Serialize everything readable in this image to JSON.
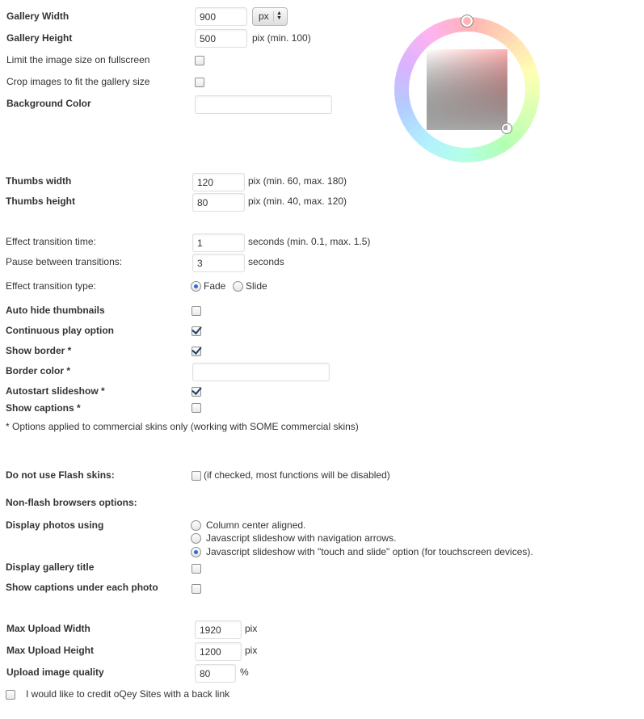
{
  "gallery": {
    "width_label": "Gallery Width",
    "width_value": "900",
    "unit_value": "px",
    "height_label": "Gallery Height",
    "height_value": "500",
    "height_hint": "pix (min. 100)",
    "limit_label": "Limit the image size on fullscreen",
    "limit_checked": false,
    "crop_label": "Crop images to fit the gallery size",
    "crop_checked": false,
    "bg_color_label": "Background Color",
    "bg_color_value": ""
  },
  "color_picker": {
    "ring_colors": [
      "#ffb3b3",
      "#ffd9b3",
      "#ffffb3",
      "#d9ffb3",
      "#b3ffb3",
      "#b3ffe6",
      "#b3f0ff",
      "#b3ccff",
      "#d9b3ff",
      "#ffb3f0"
    ],
    "selected_hue": "#ffb3b3"
  },
  "thumbs": {
    "width_label": "Thumbs width",
    "width_value": "120",
    "width_hint": "pix (min. 60, max. 180)",
    "height_label": "Thumbs height",
    "height_value": "80",
    "height_hint": "pix (min. 40, max. 120)"
  },
  "effects": {
    "time_label": "Effect transition time:",
    "time_value": "1",
    "time_hint": "seconds (min. 0.1, max. 1.5)",
    "pause_label": "Pause between transitions:",
    "pause_value": "3",
    "pause_hint": "seconds",
    "type_label": "Effect transition type:",
    "type_options": [
      "Fade",
      "Slide"
    ],
    "type_selected": "Fade"
  },
  "options": {
    "auto_hide_label": "Auto hide thumbnails",
    "auto_hide_checked": false,
    "continuous_label": "Continuous play option",
    "continuous_checked": true,
    "show_border_label": "Show border *",
    "show_border_checked": true,
    "border_color_label": "Border color *",
    "border_color_value": "",
    "autostart_label": "Autostart slideshow *",
    "autostart_checked": true,
    "show_captions_label": "Show captions *",
    "show_captions_checked": false,
    "commercial_note": "* Options applied to commercial skins only (working with SOME commercial skins)"
  },
  "flash": {
    "no_flash_label": "Do not use Flash skins:",
    "no_flash_checked": false,
    "no_flash_hint": "(if checked, most functions will be disabled)",
    "nonflash_heading": "Non-flash browsers options:",
    "display_label": "Display photos using",
    "display_options": [
      "Column center aligned.",
      "Javascript slideshow with navigation arrows.",
      "Javascript slideshow with \"touch and slide\" option (for touchscreen devices)."
    ],
    "display_selected_index": 2,
    "gallery_title_label": "Display gallery title",
    "gallery_title_checked": false,
    "captions_under_label": "Show captions under each photo",
    "captions_under_checked": false
  },
  "upload": {
    "max_width_label": "Max Upload Width",
    "max_width_value": "1920",
    "max_width_unit": "pix",
    "max_height_label": "Max Upload Height",
    "max_height_value": "1200",
    "max_height_unit": "pix",
    "quality_label": "Upload image quality",
    "quality_value": "80",
    "quality_unit": "%",
    "credit_label": "I would like to credit oQey Sites with a back link",
    "credit_checked": false
  }
}
